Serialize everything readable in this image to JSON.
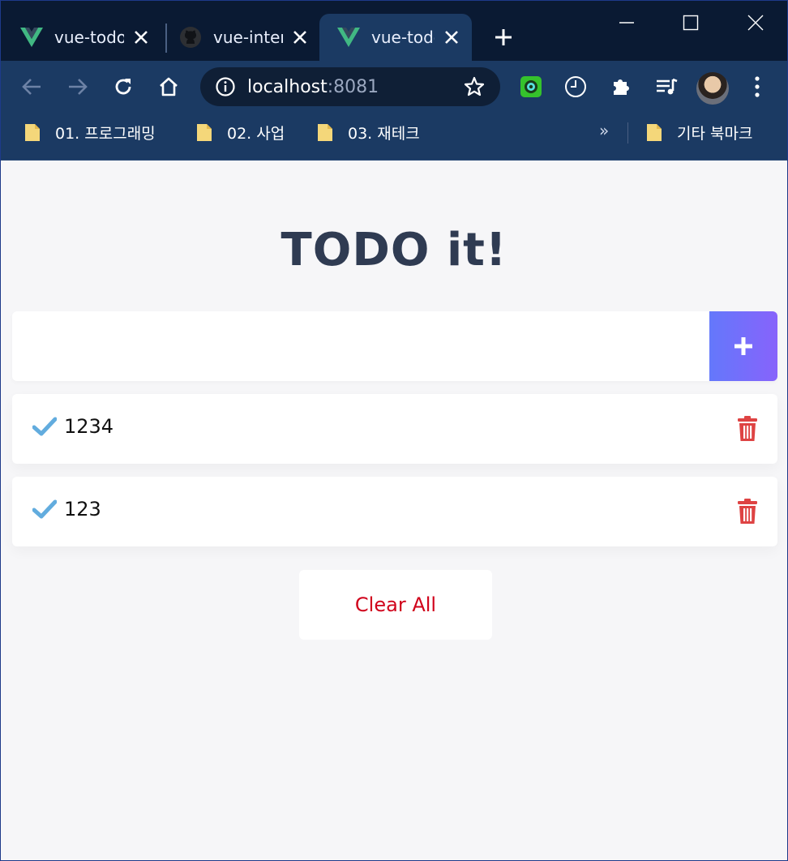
{
  "browser": {
    "tabs": [
      {
        "title": "vue-todo",
        "icon": "vue-logo-icon",
        "active": false
      },
      {
        "title": "vue-inter",
        "icon": "github-icon",
        "active": false
      },
      {
        "title": "vue-todo",
        "icon": "vue-logo-icon",
        "active": true
      }
    ],
    "address": {
      "host": "localhost",
      "port": ":8081"
    },
    "bookmarks": [
      {
        "label": "01. 프로그래밍"
      },
      {
        "label": "02. 사업"
      },
      {
        "label": "03. 재테크"
      }
    ],
    "bookmarks_more": "»",
    "other_bookmarks": "기타 북마크"
  },
  "app": {
    "title": "TODO it!",
    "input": {
      "value": "",
      "placeholder": ""
    },
    "todos": [
      {
        "text": "1234"
      },
      {
        "text": "123"
      }
    ],
    "clear_label": "Clear All"
  },
  "colors": {
    "title": "#2f3b52",
    "accent_start": "#6478fb",
    "accent_end": "#8763fb",
    "check": "#62acde",
    "delete": "#de4343",
    "clear_text": "#d0021b"
  }
}
